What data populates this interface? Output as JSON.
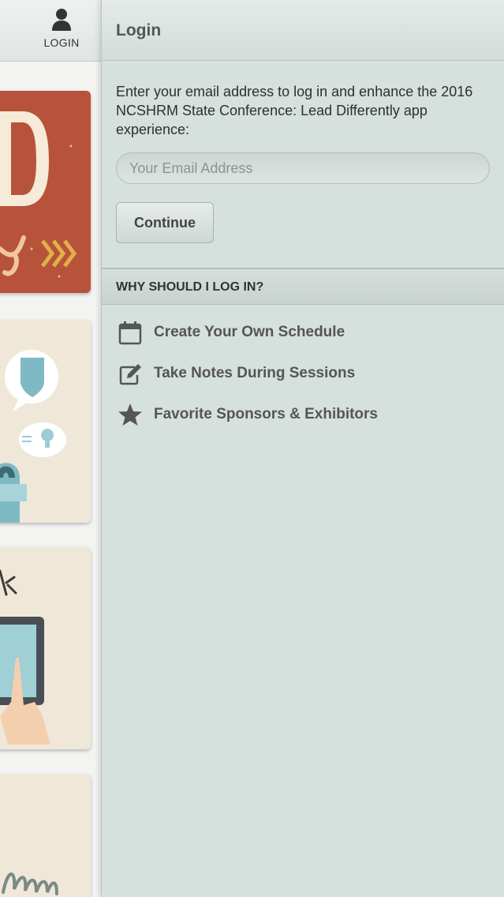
{
  "nav": {
    "login_label": "LOGIN"
  },
  "header": {
    "title": "Login"
  },
  "form": {
    "intro": "Enter your email address to log in and enhance the 2016 NCSHRM State Conference: Lead Differently app experience:",
    "email_placeholder": "Your Email Address",
    "continue_label": "Continue"
  },
  "why": {
    "heading": "WHY SHOULD I LOG IN?",
    "benefits": [
      {
        "icon": "calendar-icon",
        "label": "Create Your Own Schedule"
      },
      {
        "icon": "edit-note-icon",
        "label": "Take Notes During Sessions"
      },
      {
        "icon": "star-icon",
        "label": "Favorite Sponsors & Exhibitors"
      }
    ]
  },
  "colors": {
    "panel_bg": "#d6e0dc",
    "tile_orange": "#b7533a",
    "tile_cream": "#efe8d8",
    "accent_teal": "#7fb9c4",
    "chevron_gold": "#e0b04a"
  }
}
